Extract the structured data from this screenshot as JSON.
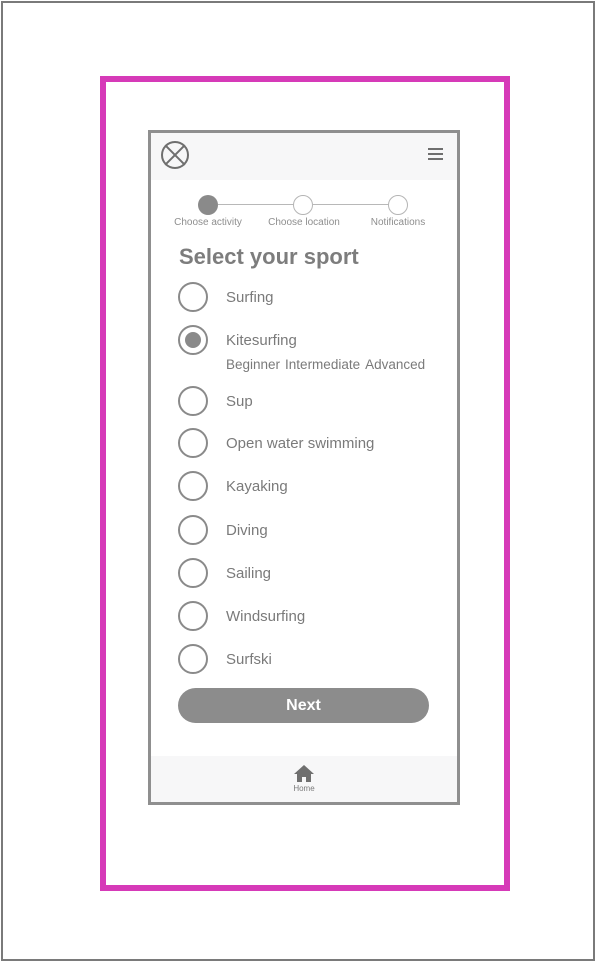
{
  "header": {
    "close_icon": "close-circle-icon",
    "menu_icon": "hamburger-menu-icon"
  },
  "stepper": {
    "steps": [
      {
        "label": "Choose activity",
        "state": "active"
      },
      {
        "label": "Choose location",
        "state": "inactive"
      },
      {
        "label": "Notifications",
        "state": "inactive"
      }
    ]
  },
  "main": {
    "title": "Select your sport",
    "options": [
      {
        "label": "Surfing",
        "selected": false
      },
      {
        "label": "Kitesurfing",
        "selected": true
      },
      {
        "label": "Sup",
        "selected": false
      },
      {
        "label": "Open water swimming",
        "selected": false
      },
      {
        "label": "Kayaking",
        "selected": false
      },
      {
        "label": "Diving",
        "selected": false
      },
      {
        "label": "Sailing",
        "selected": false
      },
      {
        "label": "Windsurfing",
        "selected": false
      },
      {
        "label": "Surfski",
        "selected": false
      }
    ],
    "levels": [
      "Beginner",
      "Intermediate",
      "Advanced"
    ],
    "next_label": "Next"
  },
  "bottom_nav": {
    "home_label": "Home",
    "home_icon": "home-icon"
  },
  "colors": {
    "frame_accent": "#d63ab8",
    "primary_gray": "#8a8a8a",
    "text_gray": "#7a7a7a"
  }
}
